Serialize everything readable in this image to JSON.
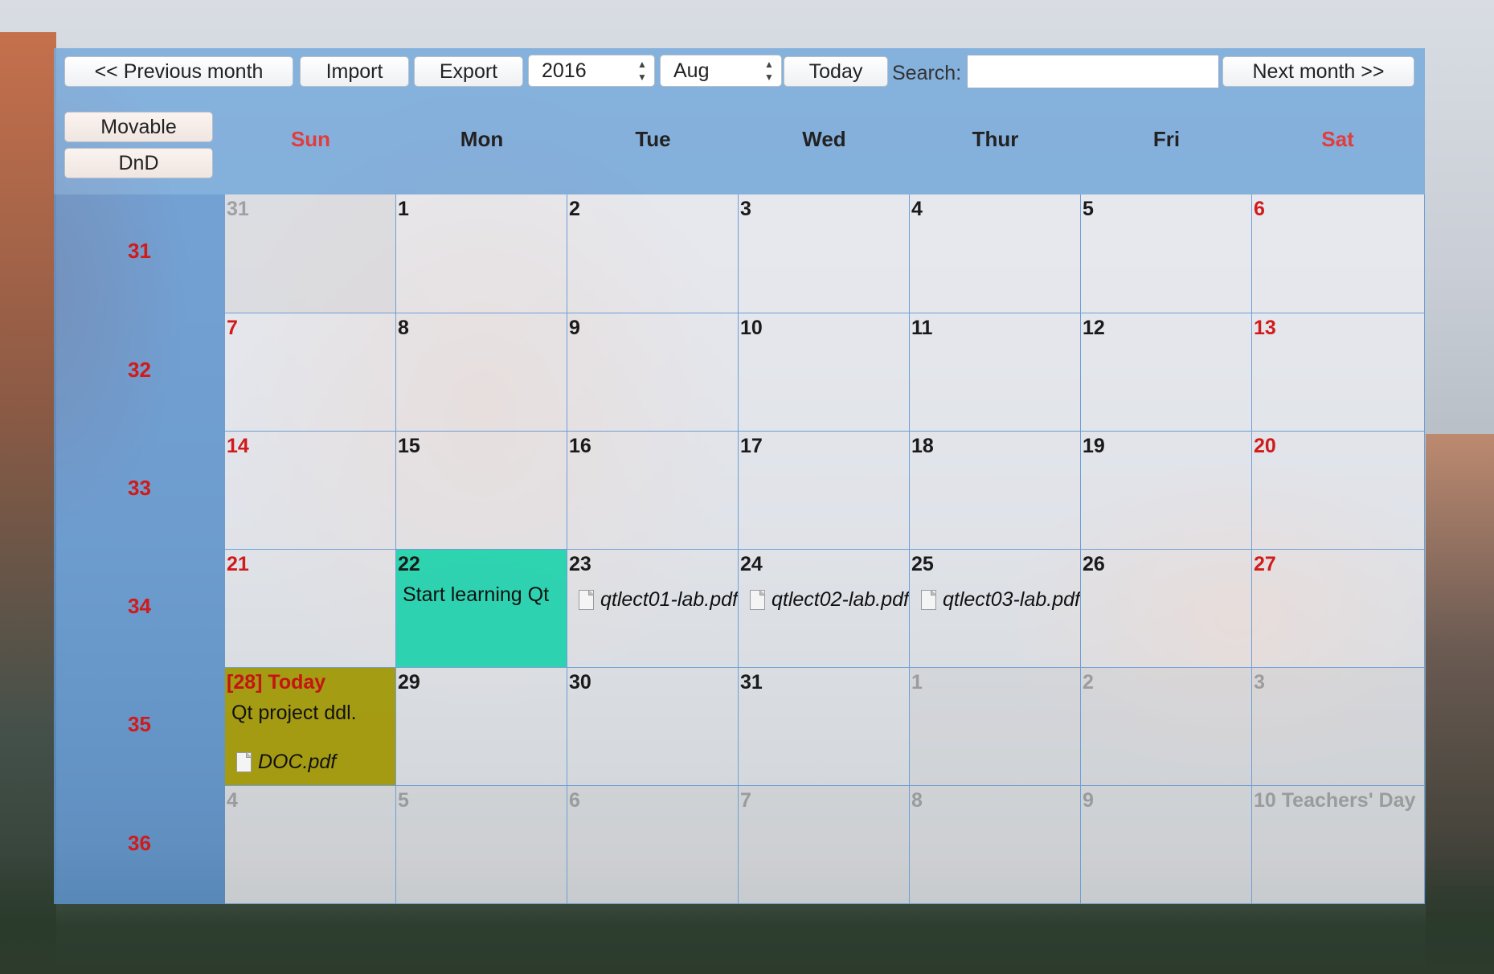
{
  "toolbar": {
    "prev_label": "<< Previous month",
    "import_label": "Import",
    "export_label": "Export",
    "year_value": "2016",
    "month_value": "Aug",
    "today_label": "Today",
    "search_label": "Search:",
    "search_value": "",
    "next_label": "Next month >>"
  },
  "side": {
    "movable_label": "Movable",
    "dnd_label": "DnD"
  },
  "days": [
    "Sun",
    "Mon",
    "Tue",
    "Wed",
    "Thur",
    "Fri",
    "Sat"
  ],
  "weeks": [
    "31",
    "32",
    "33",
    "34",
    "35",
    "36"
  ],
  "cells": [
    "31",
    "1",
    "2",
    "3",
    "4",
    "5",
    "6",
    "7",
    "8",
    "9",
    "10",
    "11",
    "12",
    "13",
    "14",
    "15",
    "16",
    "17",
    "18",
    "19",
    "20",
    "21",
    "22",
    "23",
    "24",
    "25",
    "26",
    "27",
    "[28] Today",
    "29",
    "30",
    "31",
    "1",
    "2",
    "3",
    "4",
    "5",
    "6",
    "7",
    "8",
    "9",
    "10 Teachers' Day"
  ],
  "events": {
    "start_learning": "Start learning Qt",
    "qt_project": "Qt project ddl.",
    "file_23": "qtlect01-lab.pdf",
    "file_24": "qtlect02-lab.pdf",
    "file_25": "qtlect03-lab.pdf",
    "file_28": "DOC.pdf"
  },
  "colors": {
    "event_green": "#14d0a8",
    "event_olive": "#a09600",
    "weekend_red": "#d11a1a"
  },
  "icons": {
    "file": "document-icon",
    "spinner": "up-down-arrows-icon"
  }
}
